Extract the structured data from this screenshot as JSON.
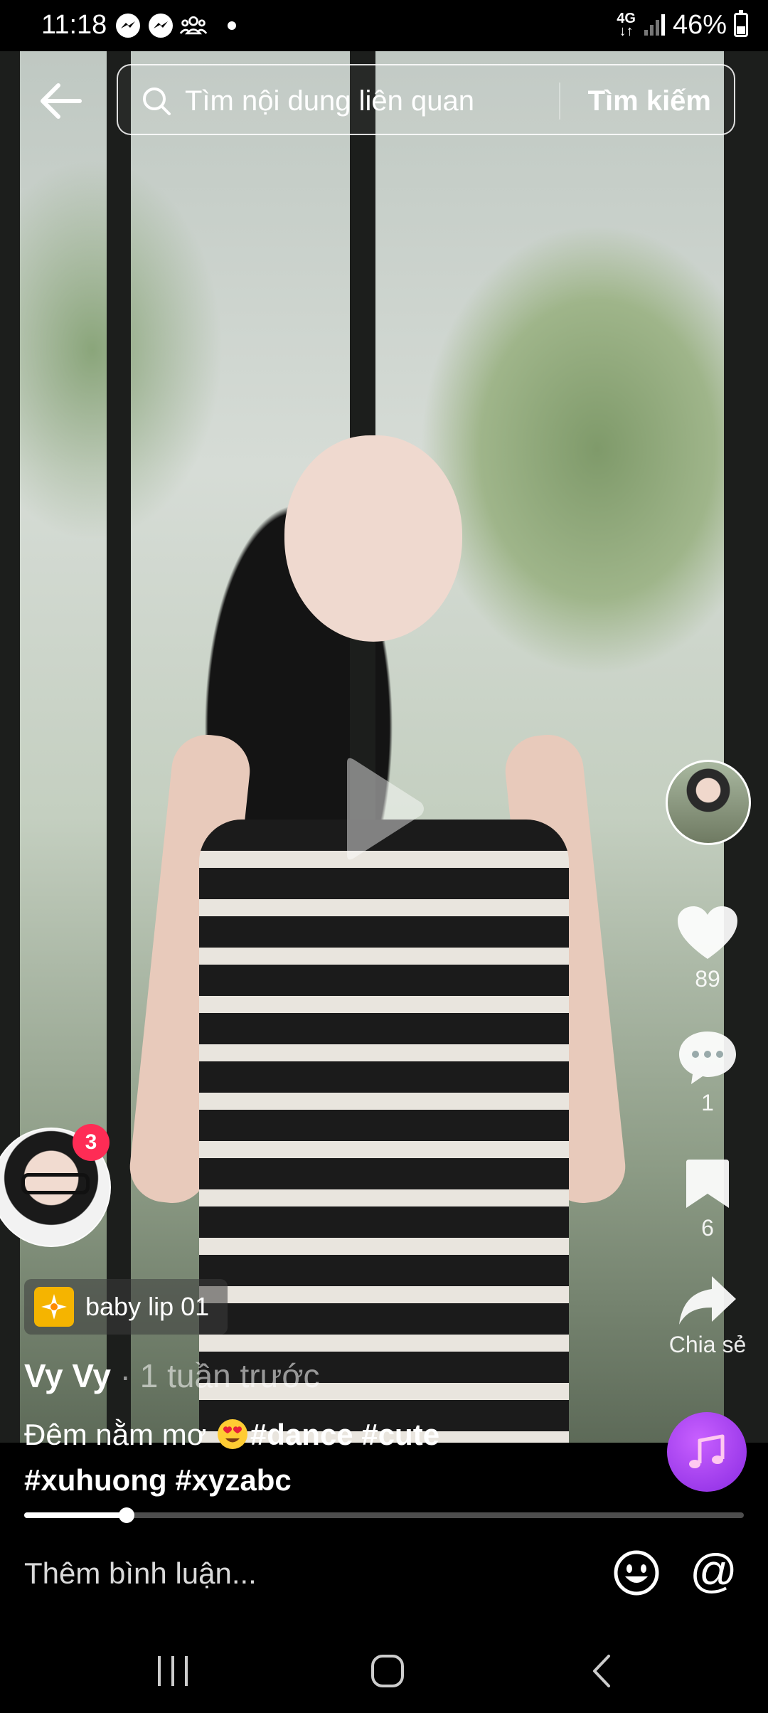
{
  "status_bar": {
    "time": "11:18",
    "network_top": "4G",
    "network_bottom": "↓↑",
    "battery": "46%",
    "left_icons": [
      "messenger-icon",
      "messenger-icon",
      "group-icon",
      "dot"
    ]
  },
  "search": {
    "placeholder": "Tìm nội dung liên quan",
    "button_label": "Tìm kiếm"
  },
  "video": {
    "playback_progress": 0.142
  },
  "rail": {
    "like_count": "89",
    "comment_count": "1",
    "save_count": "6",
    "share_label": "Chia sẻ"
  },
  "floating_avatar": {
    "badge_count": "3"
  },
  "effect": {
    "label": "baby lip 01"
  },
  "post": {
    "author": "Vy Vy",
    "time": " · 1 tuần trước",
    "caption": "Đêm nằm mơ ",
    "caption_hashtags_line1": "#dance #cute",
    "caption_hashtags_line2": "#xuhuong #xyzabc"
  },
  "comment_bar": {
    "placeholder": "Thêm bình luận...",
    "mention_symbol": "@"
  },
  "colors": {
    "accent_red": "#fe2c55",
    "music_purple": "#a64dff",
    "effect_yellow": "#f5b400"
  }
}
